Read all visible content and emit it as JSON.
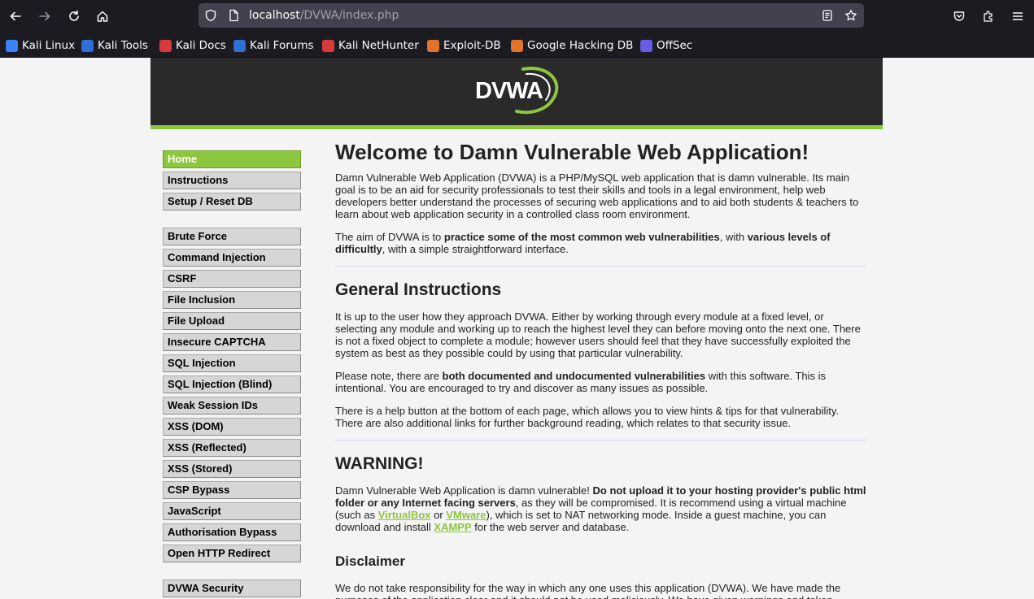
{
  "browser": {
    "url_host": "localhost",
    "url_path": "/DVWA/index.php",
    "bookmarks": [
      {
        "label": "Kali Linux",
        "color": "#3b82f6"
      },
      {
        "label": "Kali Tools",
        "color": "#2f6fd6"
      },
      {
        "label": "Kali Docs",
        "color": "#d63a3a"
      },
      {
        "label": "Kali Forums",
        "color": "#2f6fd6"
      },
      {
        "label": "Kali NetHunter",
        "color": "#d63a3a"
      },
      {
        "label": "Exploit-DB",
        "color": "#e2732a"
      },
      {
        "label": "Google Hacking DB",
        "color": "#e2732a"
      },
      {
        "label": "OffSec",
        "color": "#6b5ce7"
      }
    ]
  },
  "app": {
    "logo_text": "DVWA",
    "accent_color": "#8dc63f"
  },
  "menu": {
    "group1": [
      "Home",
      "Instructions",
      "Setup / Reset DB"
    ],
    "group2": [
      "Brute Force",
      "Command Injection",
      "CSRF",
      "File Inclusion",
      "File Upload",
      "Insecure CAPTCHA",
      "SQL Injection",
      "SQL Injection (Blind)",
      "Weak Session IDs",
      "XSS (DOM)",
      "XSS (Reflected)",
      "XSS (Stored)",
      "CSP Bypass",
      "JavaScript",
      "Authorisation Bypass",
      "Open HTTP Redirect"
    ],
    "group3": [
      "DVWA Security"
    ],
    "selected": "Home"
  },
  "main": {
    "title": "Welcome to Damn Vulnerable Web Application!",
    "intro_p1": "Damn Vulnerable Web Application (DVWA) is a PHP/MySQL web application that is damn vulnerable. Its main goal is to be an aid for security professionals to test their skills and tools in a legal environment, help web developers better understand the processes of securing web applications and to aid both students & teachers to learn about web application security in a controlled class room environment.",
    "intro_p2_a": "The aim of DVWA is to ",
    "intro_p2_b": "practice some of the most common web vulnerabilities",
    "intro_p2_c": ", with ",
    "intro_p2_d": "various levels of difficultly",
    "intro_p2_e": ", with a simple straightforward interface.",
    "general_heading": "General Instructions",
    "general_p1": "It is up to the user how they approach DVWA. Either by working through every module at a fixed level, or selecting any module and working up to reach the highest level they can before moving onto the next one. There is not a fixed object to complete a module; however users should feel that they have successfully exploited the system as best as they possible could by using that particular vulnerability.",
    "general_p2_a": "Please note, there are ",
    "general_p2_b": "both documented and undocumented vulnerabilities",
    "general_p2_c": " with this software. This is intentional. You are encouraged to try and discover as many issues as possible.",
    "general_p3": "There is a help button at the bottom of each page, which allows you to view hints & tips for that vulnerability. There are also additional links for further background reading, which relates to that security issue.",
    "warning_heading": "WARNING!",
    "warning_a": "Damn Vulnerable Web Application is damn vulnerable! ",
    "warning_b": "Do not upload it to your hosting provider's public html folder or any Internet facing servers",
    "warning_c": ", as they will be compromised. It is recommend using a virtual machine (such as ",
    "warning_link1": "VirtualBox",
    "warning_d": " or ",
    "warning_link2": "VMware",
    "warning_e": "), which is set to NAT networking mode. Inside a guest machine, you can download and install ",
    "warning_link3": "XAMPP",
    "warning_f": " for the web server and database.",
    "disclaimer_heading": "Disclaimer",
    "disclaimer_p": "We do not take responsibility for the way in which any one uses this application (DVWA). We have made the purposes of the application clear and it should not be used maliciously. We have given warnings and taken"
  }
}
